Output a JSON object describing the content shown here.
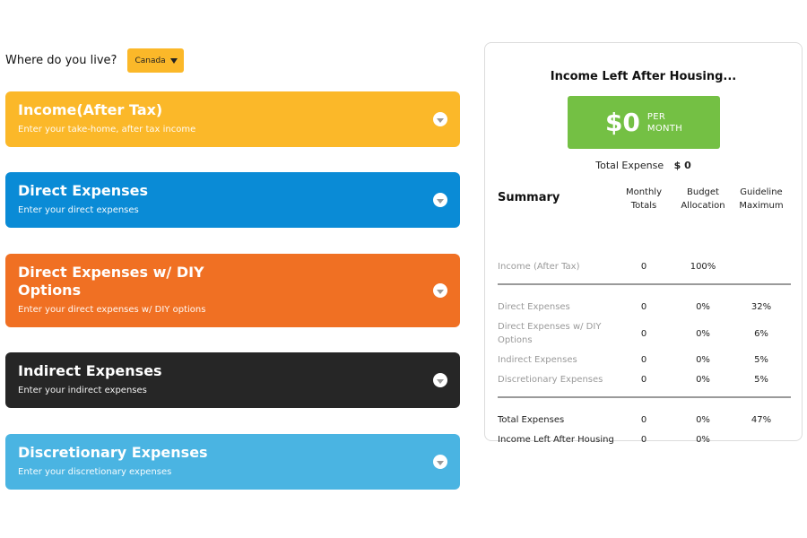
{
  "location": {
    "question": "Where do you live?",
    "selected": "Canada"
  },
  "sections": [
    {
      "title": "Income(After Tax)",
      "subtitle": "Enter your take-home, after tax income",
      "color": "#fbb829"
    },
    {
      "title": "Direct Expenses",
      "subtitle": "Enter your direct expenses",
      "color": "#0a8bd6"
    },
    {
      "title": "Direct Expenses w/ DIY Options",
      "subtitle": "Enter your direct expenses w/ DIY options",
      "color": "#f07023"
    },
    {
      "title": "Indirect Expenses",
      "subtitle": "Enter your indirect expenses",
      "color": "#262626"
    },
    {
      "title": "Discretionary Expenses",
      "subtitle": "Enter your discretionary expenses",
      "color": "#4ab4e2"
    }
  ],
  "result": {
    "heading": "Income Left After Housing...",
    "amount": "$0",
    "unit_line1": "PER",
    "unit_line2": "MONTH",
    "color": "#74c044",
    "total_expense_label": "Total Expense",
    "total_expense_value": "$ 0"
  },
  "summary": {
    "title": "Summary",
    "columns": [
      {
        "line1": "Monthly",
        "line2": "Totals"
      },
      {
        "line1": "Budget",
        "line2": "Allocation"
      },
      {
        "line1": "Guideline",
        "line2": "Maximum"
      }
    ],
    "income_row": {
      "label": "Income (After Tax)",
      "monthly": "0",
      "allocation": "100%",
      "guideline": ""
    },
    "expense_rows": [
      {
        "label": "Direct Expenses",
        "monthly": "0",
        "allocation": "0%",
        "guideline": "32%"
      },
      {
        "label": "Direct Expenses w/ DIY Options",
        "monthly": "0",
        "allocation": "0%",
        "guideline": "6%"
      },
      {
        "label": "Indirect Expenses",
        "monthly": "0",
        "allocation": "0%",
        "guideline": "5%"
      },
      {
        "label": "Discretionary Expenses",
        "monthly": "0",
        "allocation": "0%",
        "guideline": "5%"
      }
    ],
    "total_rows": [
      {
        "label": "Total Expenses",
        "monthly": "0",
        "allocation": "0%",
        "guideline": "47%"
      },
      {
        "label": "Income Left After Housing",
        "monthly": "0",
        "allocation": "0%",
        "guideline": ""
      }
    ]
  }
}
